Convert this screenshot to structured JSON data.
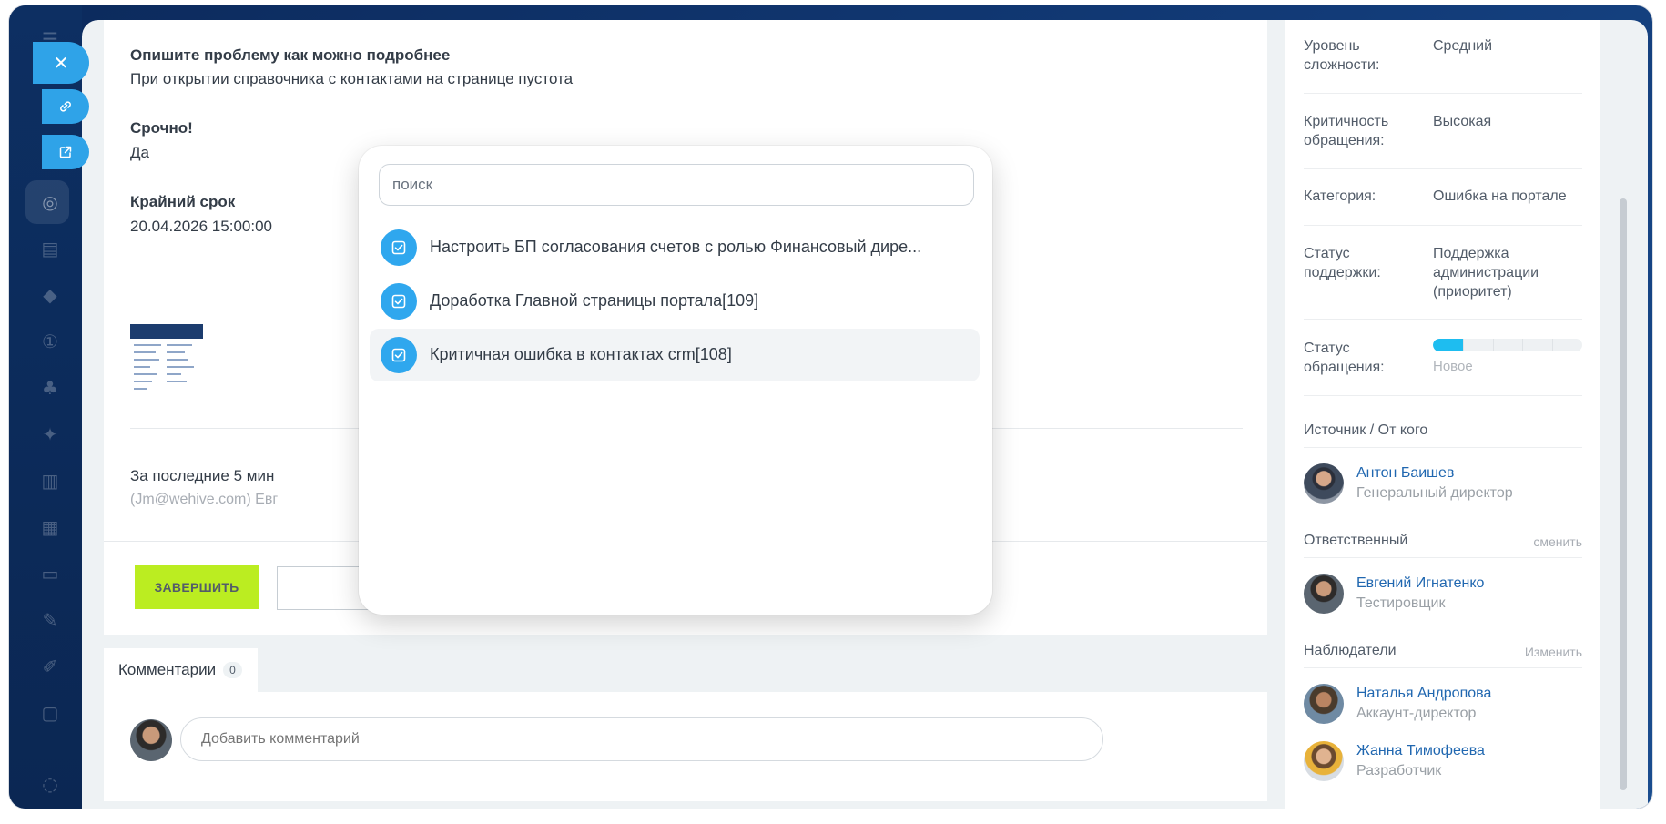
{
  "task": {
    "fields": [
      {
        "label": "Опишите проблему как можно подробнее",
        "value": "При открытии справочника с контактами на странице пустота"
      },
      {
        "label": "Срочно!",
        "value": "Да"
      },
      {
        "label": "Крайний срок",
        "value": "20.04.2026 15:00:00"
      }
    ],
    "history_text": "За последние 5 мин",
    "history_sub": "(Jm@wehive.com) Евг",
    "finish_label": "ЗАВЕРШИТЬ"
  },
  "comments": {
    "tab_label": "Комментарии",
    "count": "0",
    "placeholder": "Добавить комментарий"
  },
  "sidebar": {
    "rows": [
      {
        "label": "Уровень сложности:",
        "value": "Средний"
      },
      {
        "label": "Критичность обращения:",
        "value": "Высокая"
      },
      {
        "label": "Категория:",
        "value": "Ошибка на портале"
      },
      {
        "label": "Статус поддержки:",
        "value": "Поддержка администрации (приоритет)"
      }
    ],
    "status": {
      "label": "Статус обращения:",
      "value": "Новое",
      "progress": 0.2
    },
    "source": {
      "title": "Источник / От кого",
      "name": "Антон Баишев",
      "position": "Генеральный директор"
    },
    "responsible": {
      "title": "Ответственный",
      "action": "сменить",
      "name": "Евгений Игнатенко",
      "position": "Тестировщик"
    },
    "watchers": {
      "title": "Наблюдатели",
      "action": "Изменить",
      "people": [
        {
          "name": "Наталья Андропова",
          "position": "Аккаунт-директор"
        },
        {
          "name": "Жанна Тимофеева",
          "position": "Разработчик"
        }
      ]
    }
  },
  "popup": {
    "search_placeholder": "поиск",
    "items": [
      {
        "label": "Настроить БП согласования счетов с ролью Финансовый дире..."
      },
      {
        "label": "Доработка Главной страницы портала[109]"
      },
      {
        "label": "Критичная ошибка в контактах crm[108]"
      }
    ]
  },
  "colors": {
    "accent": "#2fa7ee",
    "finish": "#bbed21",
    "link": "#2067b0",
    "progress": "#1ebdf0"
  },
  "icons": {
    "close": "close-icon",
    "link": "link-icon",
    "open": "open-external-icon",
    "task": "task-check-icon"
  }
}
